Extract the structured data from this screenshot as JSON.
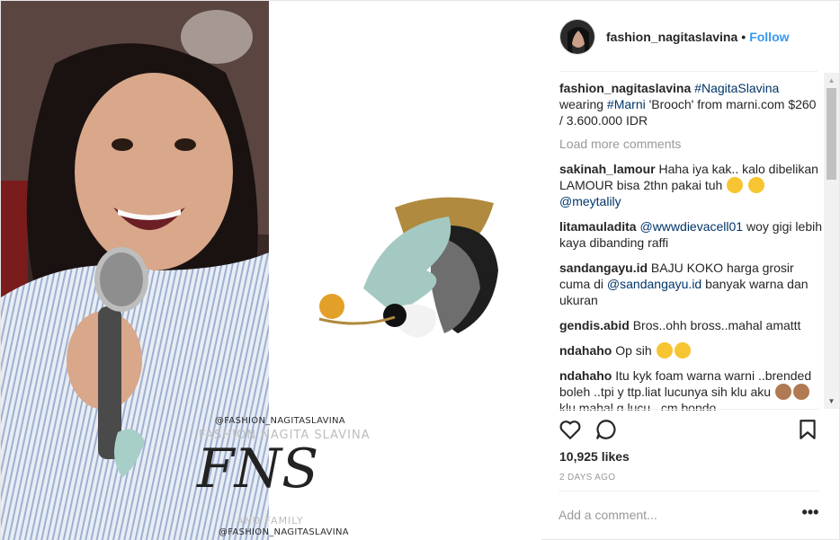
{
  "post": {
    "username": "fashion_nagitaslavina",
    "separator": "•",
    "follow_label": "Follow"
  },
  "image": {
    "watermark_handle_top": "@FASHION_NAGITASLAVINA",
    "watermark_brand": "FASHION NAGITA SLAVINA",
    "watermark_logo": "FNS",
    "watermark_sub": "AND FAMILY",
    "watermark_handle_bottom": "@FASHION_NAGITASLAVINA"
  },
  "caption": {
    "username": "fashion_nagitaslavina",
    "tag1": "#NagitaSlavina",
    "text1": " wearing ",
    "tag2": "#Marni",
    "text2": " 'Brooch' from marni.com $260 / 3.600.000 IDR"
  },
  "load_more": "Load more comments",
  "comments": [
    {
      "user": "sakinah_lamour",
      "text": "Haha iya kak.. kalo dibelikan LAMOUR bisa 2thn pakai tuh",
      "mention": "@meytalily"
    },
    {
      "user": "litamauladita",
      "mention": "@wwwdievacell01",
      "text": " woy gigi lebih kaya dibanding raffi"
    },
    {
      "user": "sandangayu.id",
      "text1": "BAJU KOKO harga grosir cuma di ",
      "mention": "@sandangayu.id",
      "text2": " banyak warna dan ukuran"
    },
    {
      "user": "gendis.abid",
      "text": "Bros..ohh bross..mahal amattt"
    },
    {
      "user": "ndahaho",
      "text": "Op sih"
    },
    {
      "user": "ndahaho",
      "text1": "Itu kyk foam warna warni ..brended boleh ..tpi y ttp.liat lucunya sih klu aku ",
      "text2": "klu mahal g lucu ..cm bondo"
    }
  ],
  "likes": "10,925 likes",
  "age": "2 DAYS AGO",
  "add_comment_placeholder": "Add a comment...",
  "more_label": "•••",
  "icons": [
    "heart-icon",
    "comment-icon",
    "bookmark-icon",
    "more-options-icon",
    "scroll-up-arrow-icon",
    "scroll-down-arrow-icon"
  ],
  "colors": {
    "follow": "#3897f0",
    "hashtag": "#003569",
    "muted": "#999999",
    "border": "#efefef"
  }
}
